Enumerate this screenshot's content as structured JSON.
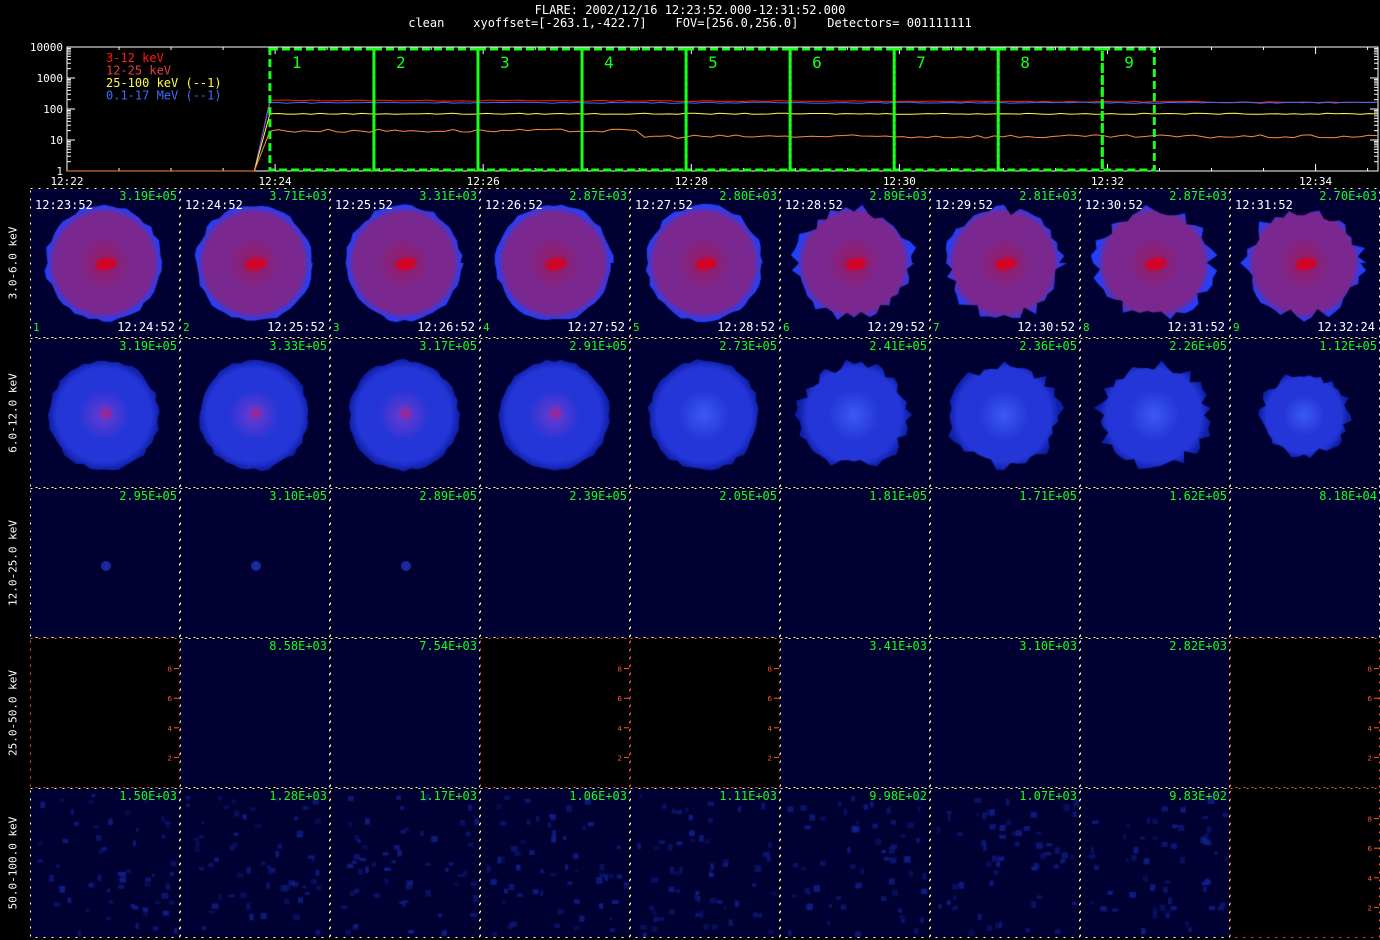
{
  "header": {
    "title_line1": "FLARE: 2002/12/16 12:23:52.000-12:31:52.000",
    "title_line2": "clean    xyoffset=[-263.1,-422.7]    FOV=[256.0,256.0]    Detectors= 001111111"
  },
  "colors": {
    "band_3_12": "#ff1a1a",
    "band_12_25": "#e04040",
    "band_25_100": "#ffff3c",
    "band_01_17": "#3c6cff",
    "interval_box": "#19ff19",
    "flux_text": "#19ff19",
    "empty_panel_axes": "#ff5a2a"
  },
  "chart_data": {
    "type": "line",
    "x_ticks": [
      "12:22",
      "12:24",
      "12:26",
      "12:28",
      "12:30",
      "12:32",
      "12:34"
    ],
    "y_scale": "log",
    "ylim": [
      1,
      10000
    ],
    "y_ticks": [
      "10000",
      "1000",
      "100",
      "10",
      "1"
    ],
    "legend_position": "top-left",
    "series": [
      {
        "name": "3-12 keV",
        "level": 190
      },
      {
        "name": "12-25 keV",
        "level": 160
      },
      {
        "name": "25-100 keV (--1)",
        "level": 70
      },
      {
        "name": "0.1-17 MeV (--1)",
        "level": 15
      }
    ],
    "intervals": [
      "1",
      "2",
      "3",
      "4",
      "5",
      "6",
      "7",
      "8",
      "9"
    ]
  },
  "images": {
    "row_labels": [
      "3.0-6.0 keV",
      "6.0-12.0 keV",
      "12.0-25.0 keV",
      "25.0-50.0 keV",
      "50.0-100.0 keV"
    ],
    "start_times": [
      "12:23:52",
      "12:24:52",
      "12:25:52",
      "12:26:52",
      "12:27:52",
      "12:28:52",
      "12:29:52",
      "12:30:52",
      "12:31:52"
    ],
    "end_times": [
      "12:24:52",
      "12:25:52",
      "12:26:52",
      "12:27:52",
      "12:28:52",
      "12:29:52",
      "12:30:52",
      "12:31:52",
      "12:32:24"
    ],
    "indices": [
      "1",
      "2",
      "3",
      "4",
      "5",
      "6",
      "7",
      "8",
      "9"
    ],
    "fluxes": [
      [
        "3.19E+05",
        "3.71E+03",
        "3.31E+03",
        "2.87E+03",
        "2.80E+03",
        "2.89E+03",
        "2.81E+03",
        "2.87E+03",
        "2.70E+03"
      ],
      [
        "3.19E+05",
        "3.33E+05",
        "3.17E+05",
        "2.91E+05",
        "2.73E+05",
        "2.41E+05",
        "2.36E+05",
        "2.26E+05",
        "1.12E+05"
      ],
      [
        "2.95E+05",
        "3.10E+05",
        "2.89E+05",
        "2.39E+05",
        "2.05E+05",
        "1.81E+05",
        "1.71E+05",
        "1.62E+05",
        "8.18E+04"
      ],
      [
        "",
        "8.58E+03",
        "7.54E+03",
        "",
        "",
        "3.41E+03",
        "3.10E+03",
        "2.82E+03",
        ""
      ],
      [
        "1.50E+03",
        "1.28E+03",
        "1.17E+03",
        "1.06E+03",
        "1.11E+03",
        "9.98E+02",
        "1.07E+03",
        "9.83E+02",
        ""
      ]
    ],
    "empty_axis_ticks": [
      "2",
      "4",
      "6",
      "8"
    ]
  }
}
